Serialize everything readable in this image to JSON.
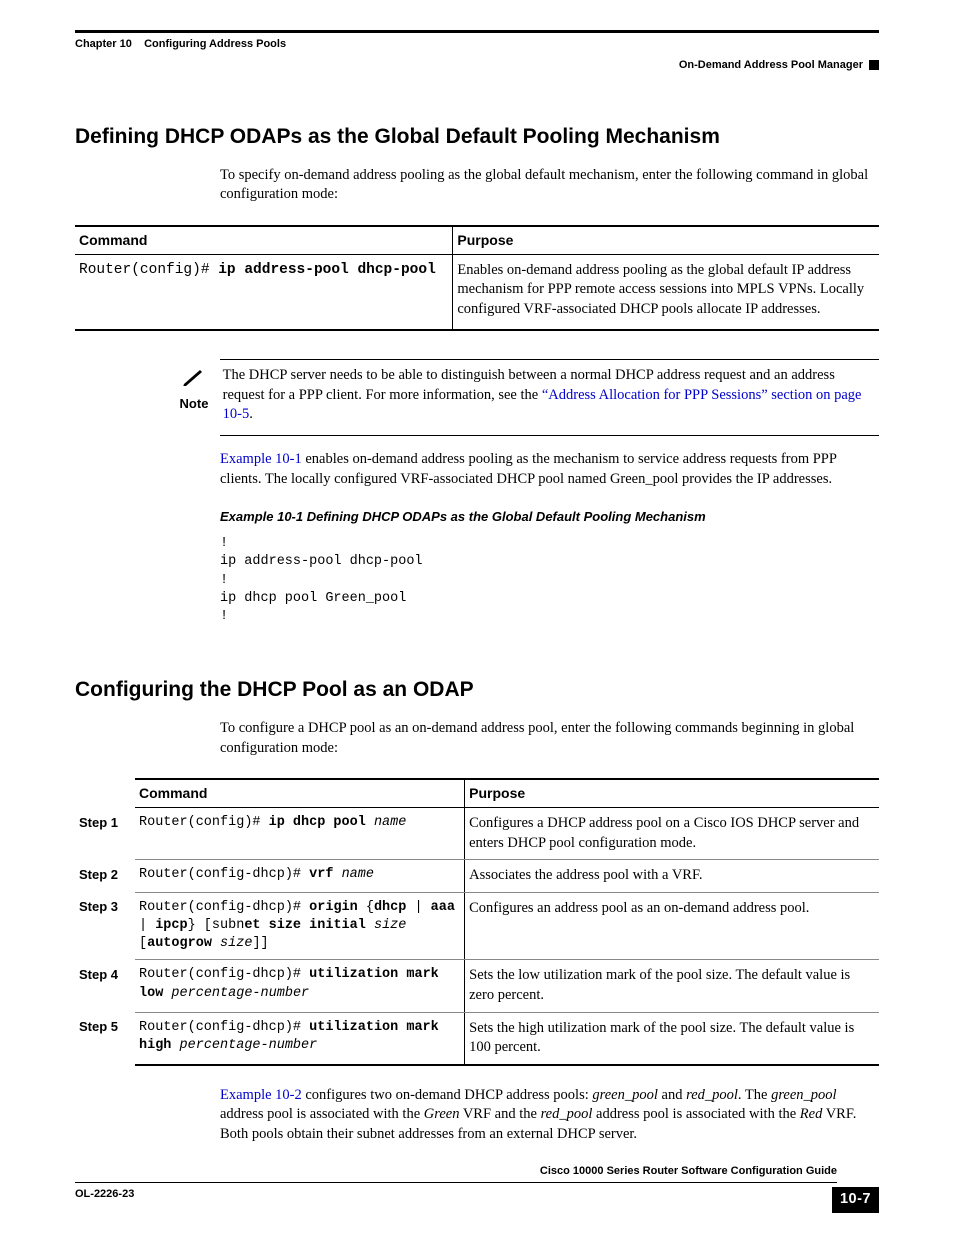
{
  "header": {
    "chapter": "Chapter 10",
    "chapter_title": "Configuring Address Pools",
    "section_right": "On-Demand Address Pool Manager"
  },
  "sec1": {
    "heading": "Defining DHCP ODAPs as the Global Default Pooling Mechanism",
    "intro": "To specify on-demand address pooling as the global default mechanism, enter the following command in global configuration mode:",
    "table": {
      "h1": "Command",
      "h2": "Purpose",
      "cmd_prompt": "Router(config)# ",
      "cmd_bold": "ip address-pool dhcp-pool",
      "purpose": "Enables on-demand address pooling as the global default IP address mechanism for PPP remote access sessions into MPLS VPNs. Locally configured VRF-associated DHCP pools allocate IP addresses."
    },
    "note": {
      "label": "Note",
      "text1": "The DHCP server needs to be able to distinguish between a normal DHCP address request and an address request for a PPP client. For more information, see the ",
      "link1": "“Address Allocation for PPP Sessions” section on page 10-5",
      "text2": "."
    },
    "para2_link": "Example 10-1",
    "para2_rest": " enables on-demand address pooling as the mechanism to service address requests from PPP clients. The locally configured VRF-associated DHCP pool named Green_pool provides the IP addresses.",
    "example_title": "Example 10-1   Defining DHCP ODAPs as the Global Default Pooling Mechanism",
    "code": "!\nip address-pool dhcp-pool\n!\nip dhcp pool Green_pool\n!"
  },
  "sec2": {
    "heading": "Configuring the DHCP Pool as an ODAP",
    "intro": "To configure a DHCP pool as an on-demand address pool, enter the following commands beginning in global configuration mode:",
    "table": {
      "h1": "Command",
      "h2": "Purpose",
      "rows": [
        {
          "step": "Step 1",
          "cmd_parts": [
            {
              "t": "Router(config)# ",
              "c": "p"
            },
            {
              "t": "ip dhcp pool",
              "c": "b"
            },
            {
              "t": " ",
              "c": "p"
            },
            {
              "t": "name",
              "c": "i"
            }
          ],
          "purpose": "Configures a DHCP address pool on a Cisco IOS DHCP server and enters DHCP pool configuration mode."
        },
        {
          "step": "Step 2",
          "cmd_parts": [
            {
              "t": "Router(config-dhcp)# ",
              "c": "p"
            },
            {
              "t": "vrf",
              "c": "b"
            },
            {
              "t": " ",
              "c": "p"
            },
            {
              "t": "name",
              "c": "i"
            }
          ],
          "purpose": "Associates the address pool with a VRF."
        },
        {
          "step": "Step 3",
          "cmd_parts": [
            {
              "t": "Router(config-dhcp)# ",
              "c": "p"
            },
            {
              "t": "origin",
              "c": "b"
            },
            {
              "t": " {",
              "c": "p"
            },
            {
              "t": "dhcp",
              "c": "b"
            },
            {
              "t": " | ",
              "c": "p"
            },
            {
              "t": "aaa",
              "c": "b"
            },
            {
              "t": " | ",
              "c": "p"
            },
            {
              "t": "ipcp",
              "c": "b"
            },
            {
              "t": "} [subn",
              "c": "p"
            },
            {
              "t": "et size initial",
              "c": "b"
            },
            {
              "t": " ",
              "c": "p"
            },
            {
              "t": "size",
              "c": "i"
            },
            {
              "t": " [",
              "c": "p"
            },
            {
              "t": "autogrow",
              "c": "b"
            },
            {
              "t": " ",
              "c": "p"
            },
            {
              "t": "size",
              "c": "i"
            },
            {
              "t": "]]",
              "c": "p"
            }
          ],
          "purpose": "Configures an address pool as an on-demand address pool."
        },
        {
          "step": "Step 4",
          "cmd_parts": [
            {
              "t": "Router(config-dhcp)# ",
              "c": "p"
            },
            {
              "t": "utilization",
              "c": "b"
            },
            {
              "t": " ",
              "c": "p"
            },
            {
              "t": "mark low",
              "c": "b"
            },
            {
              "t": " ",
              "c": "p"
            },
            {
              "t": "percentage-number",
              "c": "i"
            }
          ],
          "purpose": "Sets the low utilization mark of the pool size. The default value is zero percent."
        },
        {
          "step": "Step 5",
          "cmd_parts": [
            {
              "t": "Router(config-dhcp)# ",
              "c": "p"
            },
            {
              "t": "utilization mark high",
              "c": "b"
            },
            {
              "t": " ",
              "c": "p"
            },
            {
              "t": "percentage-number",
              "c": "i"
            }
          ],
          "purpose": "Sets the high utilization mark of the pool size. The default value is 100 percent."
        }
      ]
    },
    "para_after": {
      "link": "Example 10-2",
      "t1": " configures two on-demand DHCP address pools: ",
      "i1": "green_pool",
      "t2": " and ",
      "i2": "red_pool",
      "t3": ". The ",
      "i3": "green_pool",
      "t4": " address pool is associated with the ",
      "i4": "Green",
      "t5": " VRF and the ",
      "i5": "red_pool",
      "t6": " address pool is associated with the ",
      "i6": "Red",
      "t7": " VRF. Both pools obtain their subnet addresses from an external DHCP server."
    }
  },
  "footer": {
    "title": "Cisco 10000 Series Router Software Configuration Guide",
    "left": "OL-2226-23",
    "page": "10-7"
  }
}
